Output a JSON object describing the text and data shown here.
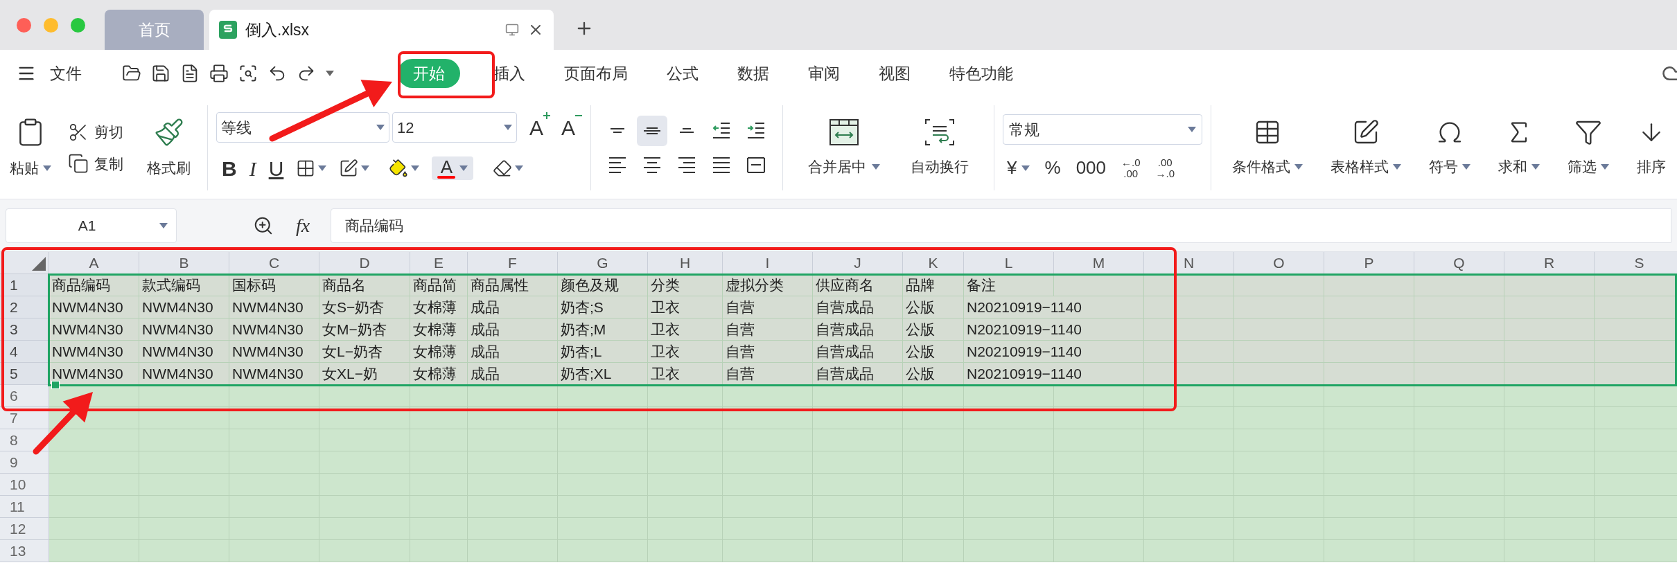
{
  "tabs": [
    {
      "label": "首页",
      "selected": false
    },
    {
      "label": "倒入.xlsx",
      "selected": true
    }
  ],
  "menu": {
    "file": "文件",
    "tabs": [
      {
        "label": "开始",
        "selected": true
      },
      {
        "label": "插入",
        "selected": false
      },
      {
        "label": "页面布局",
        "selected": false
      },
      {
        "label": "公式",
        "selected": false
      },
      {
        "label": "数据",
        "selected": false
      },
      {
        "label": "审阅",
        "selected": false
      },
      {
        "label": "视图",
        "selected": false
      },
      {
        "label": "特色功能",
        "selected": false
      }
    ]
  },
  "ribbon": {
    "paste": "粘贴",
    "cut": "剪切",
    "copy": "复制",
    "format_painter": "格式刷",
    "font": {
      "name": "等线",
      "size": "12",
      "grow": "A",
      "shrink": "A",
      "styles": [
        "B",
        "I",
        "U"
      ],
      "color_button": {
        "label": "A",
        "color": "#ff0000",
        "selected": true
      }
    },
    "align_buttons": [
      {
        "kind": "top",
        "selected": false
      },
      {
        "kind": "middle",
        "selected": true
      },
      {
        "kind": "bottom",
        "selected": false
      },
      {
        "kind": "outdent",
        "selected": false
      },
      {
        "kind": "indent",
        "selected": false
      },
      {
        "kind": "left",
        "selected": false
      },
      {
        "kind": "center",
        "selected": false
      },
      {
        "kind": "right",
        "selected": false
      },
      {
        "kind": "justify",
        "selected": false
      },
      {
        "kind": "distribute",
        "selected": false
      }
    ],
    "merge": "合并居中",
    "wrap": "自动换行",
    "number_format": "常规",
    "number_buttons": [
      {
        "label": "¥",
        "dropdown": true
      },
      {
        "label": "%",
        "dropdown": false
      },
      {
        "label": "000",
        "dropdown": false
      }
    ],
    "decimal_buttons": [
      {
        "top": "←.0",
        "bottom": ".00"
      },
      {
        "top": ".00",
        "bottom": "→.0"
      }
    ],
    "big_buttons": [
      {
        "kind": "conditional",
        "label": "条件格式",
        "dropdown": true
      },
      {
        "kind": "table_style",
        "label": "表格样式",
        "dropdown": true
      },
      {
        "kind": "symbol",
        "label": "符号",
        "dropdown": true
      },
      {
        "kind": "sum",
        "label": "求和",
        "dropdown": true
      },
      {
        "kind": "filter",
        "label": "筛选",
        "dropdown": true
      },
      {
        "kind": "sort",
        "label": "排序",
        "dropdown": false
      }
    ]
  },
  "formula_bar": {
    "cell": "A1",
    "fx": "fx",
    "value": "商品编码"
  },
  "sheet": {
    "columns": [
      "A",
      "B",
      "C",
      "D",
      "E",
      "F",
      "G",
      "H",
      "I",
      "J",
      "K",
      "L",
      "M",
      "N",
      "O",
      "P",
      "Q",
      "R",
      "S"
    ],
    "rows": [
      {
        "header": "1",
        "selected": true,
        "cells": [
          "商品编码",
          "款式编码",
          "国标码",
          "商品名",
          "商品简",
          "商品属性",
          "颜色及规",
          "分类",
          "虚拟分类",
          "供应商名",
          "品牌",
          "备注"
        ]
      },
      {
        "header": "2",
        "selected": true,
        "cells": [
          "NWM4N30",
          "NWM4N30",
          "NWM4N30",
          "女S−奶杏",
          "女棉薄",
          "成品",
          "奶杏;S",
          "卫衣",
          "自营",
          "自营成品",
          "公版",
          "N20210919−1140"
        ]
      },
      {
        "header": "3",
        "selected": true,
        "cells": [
          "NWM4N30",
          "NWM4N30",
          "NWM4N30",
          "女M−奶杏",
          "女棉薄",
          "成品",
          "奶杏;M",
          "卫衣",
          "自营",
          "自营成品",
          "公版",
          "N20210919−1140"
        ]
      },
      {
        "header": "4",
        "selected": true,
        "cells": [
          "NWM4N30",
          "NWM4N30",
          "NWM4N30",
          "女L−奶杏",
          "女棉薄",
          "成品",
          "奶杏;L",
          "卫衣",
          "自营",
          "自营成品",
          "公版",
          "N20210919−1140"
        ]
      },
      {
        "header": "5",
        "selected": true,
        "cells": [
          "NWM4N30",
          "NWM4N30",
          "NWM4N30",
          "女XL−奶",
          "女棉薄",
          "成品",
          "奶杏;XL",
          "卫衣",
          "自营",
          "自营成品",
          "公版",
          "N20210919−1140"
        ]
      },
      {
        "header": "6",
        "selected": false
      },
      {
        "header": "7",
        "selected": false
      },
      {
        "header": "8",
        "selected": false
      },
      {
        "header": "9",
        "selected": false
      },
      {
        "header": "10",
        "selected": false
      },
      {
        "header": "11",
        "selected": false
      },
      {
        "header": "12",
        "selected": false
      },
      {
        "header": "13",
        "selected": false
      }
    ]
  },
  "annotations": [
    {
      "kind": "box"
    },
    {
      "kind": "arrow"
    },
    {
      "kind": "box"
    },
    {
      "kind": "arrow"
    }
  ]
}
